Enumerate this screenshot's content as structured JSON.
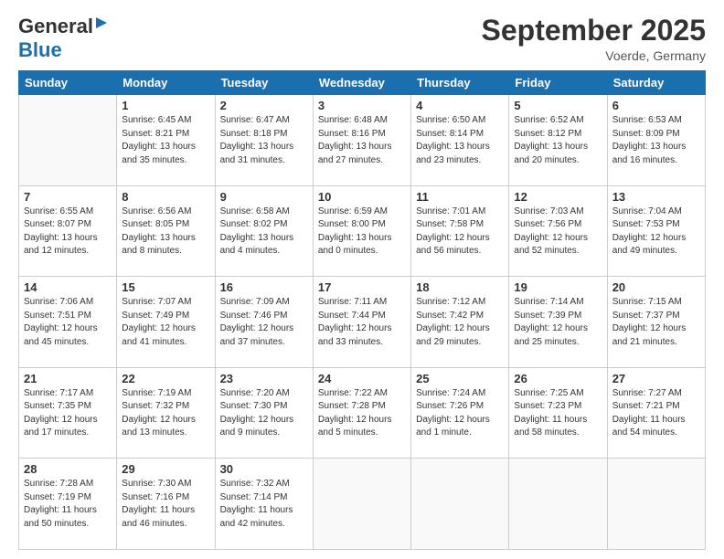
{
  "header": {
    "logo_general": "General",
    "logo_blue": "Blue",
    "title": "September 2025",
    "location": "Voerde, Germany"
  },
  "days_of_week": [
    "Sunday",
    "Monday",
    "Tuesday",
    "Wednesday",
    "Thursday",
    "Friday",
    "Saturday"
  ],
  "weeks": [
    [
      {
        "day": "",
        "info": ""
      },
      {
        "day": "1",
        "info": "Sunrise: 6:45 AM\nSunset: 8:21 PM\nDaylight: 13 hours\nand 35 minutes."
      },
      {
        "day": "2",
        "info": "Sunrise: 6:47 AM\nSunset: 8:18 PM\nDaylight: 13 hours\nand 31 minutes."
      },
      {
        "day": "3",
        "info": "Sunrise: 6:48 AM\nSunset: 8:16 PM\nDaylight: 13 hours\nand 27 minutes."
      },
      {
        "day": "4",
        "info": "Sunrise: 6:50 AM\nSunset: 8:14 PM\nDaylight: 13 hours\nand 23 minutes."
      },
      {
        "day": "5",
        "info": "Sunrise: 6:52 AM\nSunset: 8:12 PM\nDaylight: 13 hours\nand 20 minutes."
      },
      {
        "day": "6",
        "info": "Sunrise: 6:53 AM\nSunset: 8:09 PM\nDaylight: 13 hours\nand 16 minutes."
      }
    ],
    [
      {
        "day": "7",
        "info": "Sunrise: 6:55 AM\nSunset: 8:07 PM\nDaylight: 13 hours\nand 12 minutes."
      },
      {
        "day": "8",
        "info": "Sunrise: 6:56 AM\nSunset: 8:05 PM\nDaylight: 13 hours\nand 8 minutes."
      },
      {
        "day": "9",
        "info": "Sunrise: 6:58 AM\nSunset: 8:02 PM\nDaylight: 13 hours\nand 4 minutes."
      },
      {
        "day": "10",
        "info": "Sunrise: 6:59 AM\nSunset: 8:00 PM\nDaylight: 13 hours\nand 0 minutes."
      },
      {
        "day": "11",
        "info": "Sunrise: 7:01 AM\nSunset: 7:58 PM\nDaylight: 12 hours\nand 56 minutes."
      },
      {
        "day": "12",
        "info": "Sunrise: 7:03 AM\nSunset: 7:56 PM\nDaylight: 12 hours\nand 52 minutes."
      },
      {
        "day": "13",
        "info": "Sunrise: 7:04 AM\nSunset: 7:53 PM\nDaylight: 12 hours\nand 49 minutes."
      }
    ],
    [
      {
        "day": "14",
        "info": "Sunrise: 7:06 AM\nSunset: 7:51 PM\nDaylight: 12 hours\nand 45 minutes."
      },
      {
        "day": "15",
        "info": "Sunrise: 7:07 AM\nSunset: 7:49 PM\nDaylight: 12 hours\nand 41 minutes."
      },
      {
        "day": "16",
        "info": "Sunrise: 7:09 AM\nSunset: 7:46 PM\nDaylight: 12 hours\nand 37 minutes."
      },
      {
        "day": "17",
        "info": "Sunrise: 7:11 AM\nSunset: 7:44 PM\nDaylight: 12 hours\nand 33 minutes."
      },
      {
        "day": "18",
        "info": "Sunrise: 7:12 AM\nSunset: 7:42 PM\nDaylight: 12 hours\nand 29 minutes."
      },
      {
        "day": "19",
        "info": "Sunrise: 7:14 AM\nSunset: 7:39 PM\nDaylight: 12 hours\nand 25 minutes."
      },
      {
        "day": "20",
        "info": "Sunrise: 7:15 AM\nSunset: 7:37 PM\nDaylight: 12 hours\nand 21 minutes."
      }
    ],
    [
      {
        "day": "21",
        "info": "Sunrise: 7:17 AM\nSunset: 7:35 PM\nDaylight: 12 hours\nand 17 minutes."
      },
      {
        "day": "22",
        "info": "Sunrise: 7:19 AM\nSunset: 7:32 PM\nDaylight: 12 hours\nand 13 minutes."
      },
      {
        "day": "23",
        "info": "Sunrise: 7:20 AM\nSunset: 7:30 PM\nDaylight: 12 hours\nand 9 minutes."
      },
      {
        "day": "24",
        "info": "Sunrise: 7:22 AM\nSunset: 7:28 PM\nDaylight: 12 hours\nand 5 minutes."
      },
      {
        "day": "25",
        "info": "Sunrise: 7:24 AM\nSunset: 7:26 PM\nDaylight: 12 hours\nand 1 minute."
      },
      {
        "day": "26",
        "info": "Sunrise: 7:25 AM\nSunset: 7:23 PM\nDaylight: 11 hours\nand 58 minutes."
      },
      {
        "day": "27",
        "info": "Sunrise: 7:27 AM\nSunset: 7:21 PM\nDaylight: 11 hours\nand 54 minutes."
      }
    ],
    [
      {
        "day": "28",
        "info": "Sunrise: 7:28 AM\nSunset: 7:19 PM\nDaylight: 11 hours\nand 50 minutes."
      },
      {
        "day": "29",
        "info": "Sunrise: 7:30 AM\nSunset: 7:16 PM\nDaylight: 11 hours\nand 46 minutes."
      },
      {
        "day": "30",
        "info": "Sunrise: 7:32 AM\nSunset: 7:14 PM\nDaylight: 11 hours\nand 42 minutes."
      },
      {
        "day": "",
        "info": ""
      },
      {
        "day": "",
        "info": ""
      },
      {
        "day": "",
        "info": ""
      },
      {
        "day": "",
        "info": ""
      }
    ]
  ]
}
